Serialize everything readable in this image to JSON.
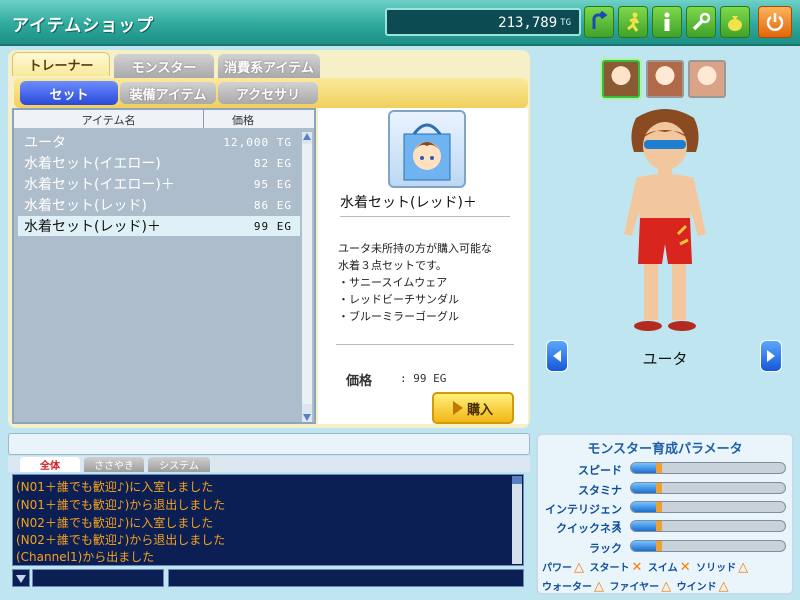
{
  "header": {
    "title": "アイテムショップ",
    "money": "213,789",
    "money_unit": "TG",
    "buttons": [
      "back-icon",
      "run-icon",
      "info-icon",
      "wrench-icon",
      "moneybag-icon",
      "power-icon"
    ]
  },
  "tabs": [
    "トレーナー",
    "モンスター",
    "消費系アイテム"
  ],
  "subtabs": [
    "セット",
    "装備アイテム",
    "アクセサリ"
  ],
  "list": {
    "headers": [
      "アイテム名",
      "価格"
    ],
    "rows": [
      {
        "name": "ユータ",
        "price": "12,000 TG"
      },
      {
        "name": "水着セット(イエロー)",
        "price": "82 EG"
      },
      {
        "name": "水着セット(イエロー)＋",
        "price": "95 EG"
      },
      {
        "name": "水着セット(レッド)",
        "price": "86 EG"
      },
      {
        "name": "水着セット(レッド)＋",
        "price": "99 EG"
      }
    ],
    "selected_index": 4
  },
  "detail": {
    "item_name": "水着セット(レッド)＋",
    "description": [
      "ユータ未所持の方が購入可能な",
      "水着３点セットです。",
      "・サニースイムウェア",
      "・レッドビーチサンダル",
      "・ブルーミラーゴーグル"
    ],
    "price_label": "価格",
    "price_value": ":  99  EG",
    "buy_label": "購入"
  },
  "character": {
    "name": "ユータ"
  },
  "chat": {
    "tabs": [
      "全体",
      "ささやき",
      "システム"
    ],
    "lines": [
      "(N01＋誰でも歓迎♪)に入室しました",
      "(N01＋誰でも歓迎♪)から退出しました",
      "(N02＋誰でも歓迎♪)に入室しました",
      "(N02＋誰でも歓迎♪)から退出しました",
      "(Channel1)から出ました"
    ]
  },
  "params": {
    "title": "モンスター育成パラメータ",
    "stats": [
      {
        "label": "スピード",
        "level": 0.2
      },
      {
        "label": "スタミナ",
        "level": 0.2
      },
      {
        "label": "インテリジェンス",
        "level": 0.2
      },
      {
        "label": "クイックネス",
        "level": 0.2
      },
      {
        "label": "ラック",
        "level": 0.2
      }
    ],
    "attrs_row1": [
      {
        "label": "パワー",
        "mark": "△"
      },
      {
        "label": "スタート",
        "mark": "✕"
      },
      {
        "label": "スイム",
        "mark": "✕"
      },
      {
        "label": "ソリッド",
        "mark": "△"
      }
    ],
    "attrs_row2": [
      {
        "label": "ウォーター",
        "mark": "△"
      },
      {
        "label": "ファイヤー",
        "mark": "△"
      },
      {
        "label": "ウインド",
        "mark": "△"
      }
    ]
  }
}
